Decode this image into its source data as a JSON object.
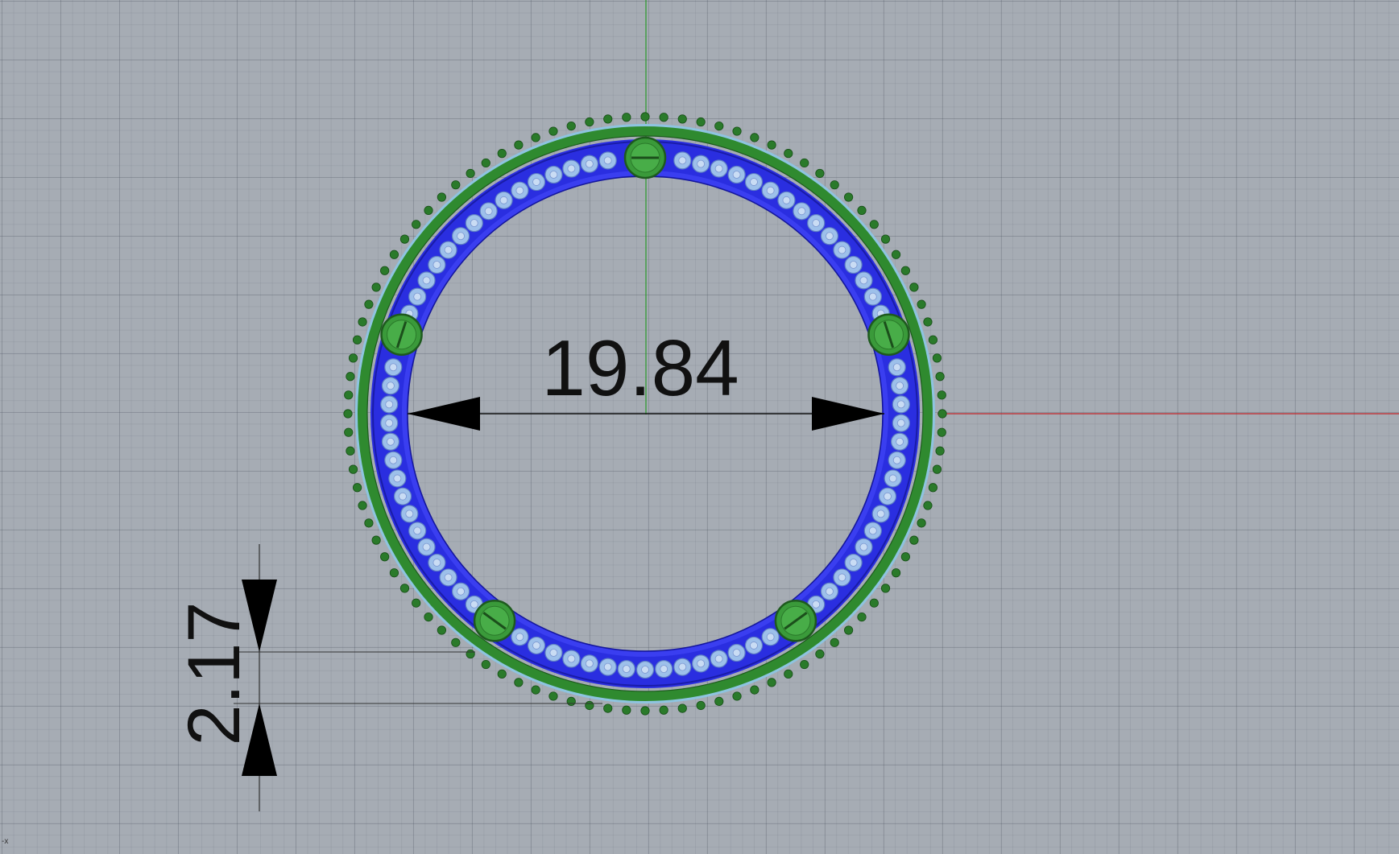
{
  "viewport": {
    "background": "#a6acb4",
    "x_axis_color": "#c0262a",
    "y_axis_color": "#2a9a2a",
    "axis_glyph": "-x"
  },
  "part": {
    "outer_ring_color": "#2f8a2f",
    "teeth_color": "#2a7a2a",
    "inner_ring_color": "#2a2ee0",
    "gem_color": "#9dc0ea",
    "screw_color": "#3a9a3a",
    "gem_count_per_segment": 14,
    "screw_count": 5,
    "teeth_count": 100
  },
  "dimensions": {
    "diameter": {
      "value": "19.84"
    },
    "thickness": {
      "value": "2.17"
    }
  }
}
